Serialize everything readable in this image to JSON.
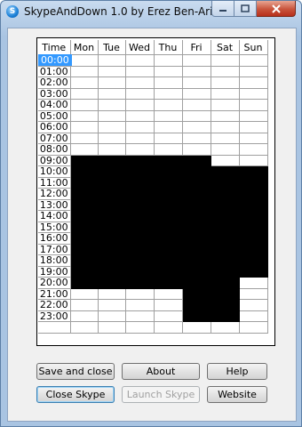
{
  "window": {
    "title": "SkypeAndDown 1.0 by Erez Ben-Ari",
    "icon": "skype-icon"
  },
  "schedule": {
    "headers": [
      "Time",
      "Mon",
      "Tue",
      "Wed",
      "Thu",
      "Fri",
      "Sat",
      "Sun"
    ],
    "selected_time": "00:00",
    "rows": [
      {
        "time": "00:00",
        "cells": [
          0,
          0,
          0,
          0,
          0,
          0,
          0
        ]
      },
      {
        "time": "01:00",
        "cells": [
          0,
          0,
          0,
          0,
          0,
          0,
          0
        ]
      },
      {
        "time": "02:00",
        "cells": [
          0,
          0,
          0,
          0,
          0,
          0,
          0
        ]
      },
      {
        "time": "03:00",
        "cells": [
          0,
          0,
          0,
          0,
          0,
          0,
          0
        ]
      },
      {
        "time": "04:00",
        "cells": [
          0,
          0,
          0,
          0,
          0,
          0,
          0
        ]
      },
      {
        "time": "05:00",
        "cells": [
          0,
          0,
          0,
          0,
          0,
          0,
          0
        ]
      },
      {
        "time": "06:00",
        "cells": [
          0,
          0,
          0,
          0,
          0,
          0,
          0
        ]
      },
      {
        "time": "07:00",
        "cells": [
          0,
          0,
          0,
          0,
          0,
          0,
          0
        ]
      },
      {
        "time": "08:00",
        "cells": [
          0,
          0,
          0,
          0,
          0,
          0,
          0
        ]
      },
      {
        "time": "09:00",
        "cells": [
          1,
          1,
          1,
          1,
          1,
          0,
          0
        ]
      },
      {
        "time": "10:00",
        "cells": [
          1,
          1,
          1,
          1,
          1,
          1,
          1
        ]
      },
      {
        "time": "11:00",
        "cells": [
          1,
          1,
          1,
          1,
          1,
          1,
          1
        ]
      },
      {
        "time": "12:00",
        "cells": [
          1,
          1,
          1,
          1,
          1,
          1,
          1
        ]
      },
      {
        "time": "13:00",
        "cells": [
          1,
          1,
          1,
          1,
          1,
          1,
          1
        ]
      },
      {
        "time": "14:00",
        "cells": [
          1,
          1,
          1,
          1,
          1,
          1,
          1
        ]
      },
      {
        "time": "15:00",
        "cells": [
          1,
          1,
          1,
          1,
          1,
          1,
          1
        ]
      },
      {
        "time": "16:00",
        "cells": [
          1,
          1,
          1,
          1,
          1,
          1,
          1
        ]
      },
      {
        "time": "17:00",
        "cells": [
          1,
          1,
          1,
          1,
          1,
          1,
          1
        ]
      },
      {
        "time": "18:00",
        "cells": [
          1,
          1,
          1,
          1,
          1,
          1,
          1
        ]
      },
      {
        "time": "19:00",
        "cells": [
          1,
          1,
          1,
          1,
          1,
          1,
          1
        ]
      },
      {
        "time": "20:00",
        "cells": [
          1,
          1,
          1,
          1,
          1,
          1,
          0
        ]
      },
      {
        "time": "21:00",
        "cells": [
          0,
          0,
          0,
          0,
          1,
          1,
          0
        ]
      },
      {
        "time": "22:00",
        "cells": [
          0,
          0,
          0,
          0,
          1,
          1,
          0
        ]
      },
      {
        "time": "23:00",
        "cells": [
          0,
          0,
          0,
          0,
          1,
          1,
          0
        ]
      },
      {
        "time": "",
        "cells": [
          0,
          0,
          0,
          0,
          0,
          0,
          0
        ]
      }
    ],
    "blocked_color": "#000000",
    "selection_color": "#3399ff"
  },
  "buttons": {
    "save_close": "Save and close",
    "about": "About",
    "help": "Help",
    "close_skype": "Close Skype",
    "launch_skype": "Launch Skype",
    "website": "Website"
  }
}
